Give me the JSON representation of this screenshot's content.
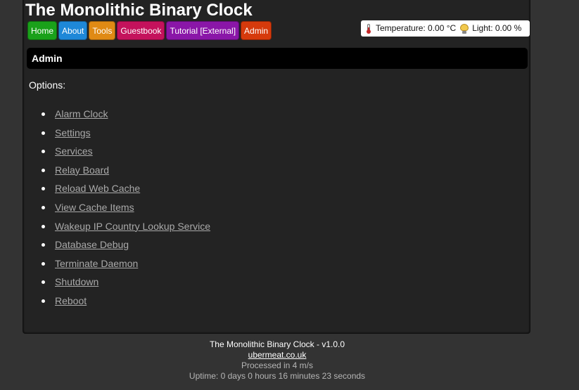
{
  "header": {
    "title": "The Monolithic Binary Clock"
  },
  "nav": {
    "items": [
      {
        "label": "Home",
        "color": "#1aa11a"
      },
      {
        "label": "About",
        "color": "#1e88d8"
      },
      {
        "label": "Tools",
        "color": "#e08a14"
      },
      {
        "label": "Guestbook",
        "color": "#c4125c"
      },
      {
        "label": "Tutorial [External]",
        "color": "#8a16a8"
      },
      {
        "label": "Admin",
        "color": "#d63a0c"
      }
    ]
  },
  "sensors": {
    "temperature_text": "Temperature: 0.00 °C",
    "light_text": "Light: 0.00 %",
    "temperature_icon": "thermometer-icon",
    "light_icon": "lightbulb-icon"
  },
  "section": {
    "title": "Admin"
  },
  "options": {
    "label": "Options:",
    "items": [
      "Alarm Clock",
      "Settings",
      "Services",
      "Relay Board",
      "Reload Web Cache",
      "View Cache Items",
      "Wakeup IP Country Lookup Service",
      "Database Debug",
      "Terminate Daemon",
      "Shutdown",
      "Reboot"
    ]
  },
  "footer": {
    "title": "The Monolithic Binary Clock - v1.0.0",
    "link": "ubermeat.co.uk",
    "processed": "Processed in 4 m/s",
    "uptime": "Uptime: 0 days 0 hours 16 minutes 23 seconds"
  }
}
